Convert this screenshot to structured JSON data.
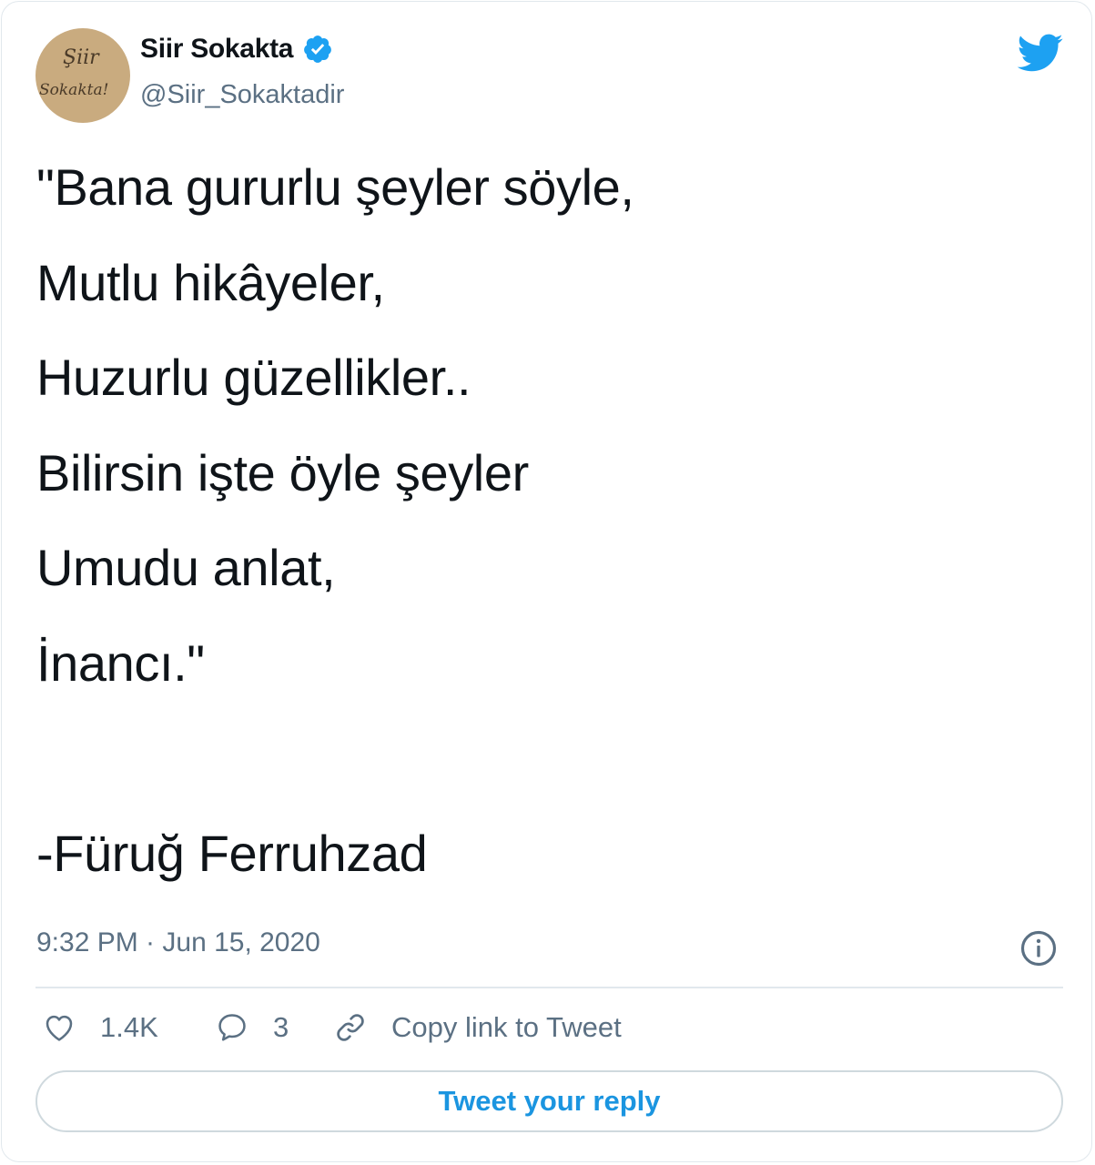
{
  "author": {
    "name": "Siir Sokakta",
    "handle": "@Siir_Sokaktadir",
    "avatar_text_line1": "Şiir",
    "avatar_text_line2": "Sokakta!",
    "verified": true
  },
  "tweet": {
    "lines": [
      "\"Bana gururlu şeyler söyle,",
      "Mutlu hikâyeler,",
      "Huzurlu güzellikler..",
      "Bilirsin işte öyle şeyler",
      "Umudu anlat,",
      "İnancı.\"",
      "",
      "-Füruğ Ferruhzad"
    ],
    "timestamp": "9:32 PM · Jun 15, 2020"
  },
  "actions": {
    "likes": "1.4K",
    "replies": "3",
    "copy_link": "Copy link to Tweet"
  },
  "reply_button": "Tweet your reply",
  "colors": {
    "accent": "#1b95e0",
    "twitter_blue": "#1da1f2",
    "secondary_text": "#5b7083",
    "primary_text": "#0f1419",
    "border": "#e1e8ed"
  },
  "icons": [
    "verified-badge-icon",
    "twitter-bird-icon",
    "info-icon",
    "heart-icon",
    "reply-bubble-icon",
    "link-icon"
  ]
}
